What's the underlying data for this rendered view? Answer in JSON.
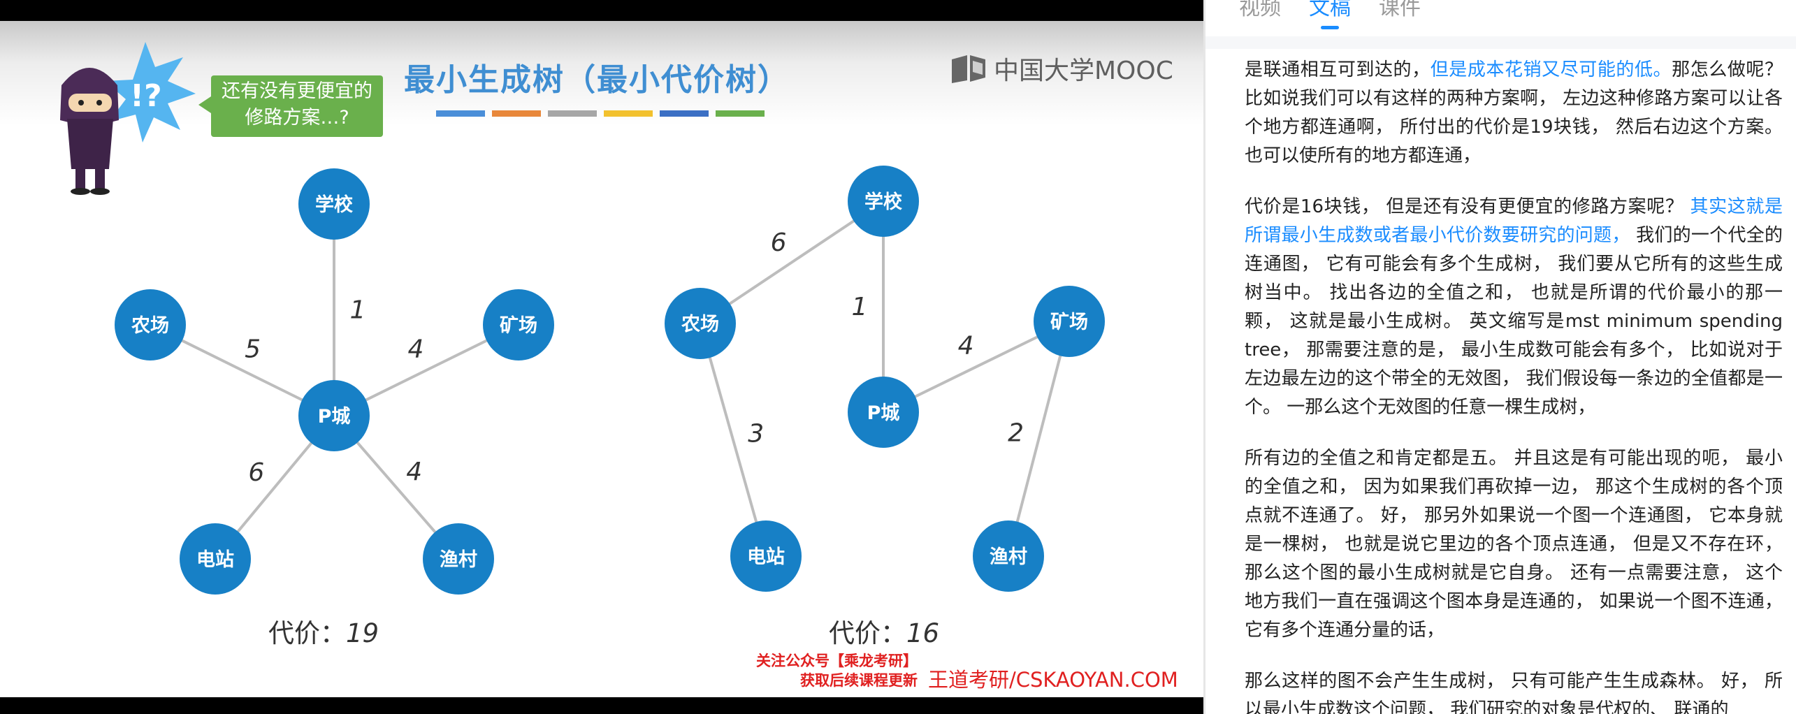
{
  "slide": {
    "title": "最小生成树（最小代价树）",
    "title_bar_colors": [
      "#4a8ed8",
      "#e8873a",
      "#a6a6a6",
      "#f2c12e",
      "#3b6fc4",
      "#6ab04c"
    ],
    "question_bubble": [
      "还有没有更便宜的",
      "修路方案…?"
    ],
    "ninja_glyph": "!?",
    "mooc_logo_icon": "mooc-book-icon",
    "mooc_logo_text": "中国大学MOOC",
    "left_cost_label": "代价：",
    "left_cost_value": "19",
    "right_cost_label": "代价：",
    "right_cost_value": "16",
    "promo_line1": "关注公众号【乘龙考研】",
    "promo_line2": "获取后续课程更新",
    "watermark": "王道考研/CSKAOYAN.COM",
    "node_color": "#1780c6",
    "edge_color": "#bdbdbd"
  },
  "left_graph": {
    "nodes": [
      "学校",
      "农场",
      "矿场",
      "P城",
      "电站",
      "渔村"
    ],
    "edges": [
      {
        "from": "P城",
        "to": "学校",
        "weight": "1"
      },
      {
        "from": "P城",
        "to": "农场",
        "weight": "5"
      },
      {
        "from": "P城",
        "to": "矿场",
        "weight": "4"
      },
      {
        "from": "P城",
        "to": "电站",
        "weight": "6"
      },
      {
        "from": "P城",
        "to": "渔村",
        "weight": "4"
      }
    ]
  },
  "right_graph": {
    "nodes": [
      "学校",
      "农场",
      "矿场",
      "P城",
      "电站",
      "渔村"
    ],
    "edges": [
      {
        "from": "学校",
        "to": "农场",
        "weight": "6"
      },
      {
        "from": "学校",
        "to": "P城",
        "weight": "1"
      },
      {
        "from": "P城",
        "to": "矿场",
        "weight": "4"
      },
      {
        "from": "农场",
        "to": "电站",
        "weight": "3"
      },
      {
        "from": "矿场",
        "to": "渔村",
        "weight": "2"
      }
    ]
  },
  "panel": {
    "tabs": [
      {
        "label": "视频",
        "active": false
      },
      {
        "label": "文稿",
        "active": true
      },
      {
        "label": "课件",
        "active": false
      }
    ],
    "paragraphs": [
      [
        {
          "t": "是联通相互可到达的，",
          "hl": false
        },
        {
          "t": "但是成本花销又尽可能的低。",
          "hl": true
        },
        {
          "t": "那怎么做呢？ 比如说我们可以有这样的两种方案啊， 左边这种修路方案可以让各个地方都连通啊， 所付出的代价是19块钱， 然后右边这个方案。 也可以使所有的地方都连通，",
          "hl": false
        }
      ],
      [
        {
          "t": "代价是16块钱， 但是还有没有更便宜的修路方案呢？ ",
          "hl": false
        },
        {
          "t": "其实这就是所谓最小生成数或者最小代价数要研究的问题，",
          "hl": true
        },
        {
          "t": " 我们的一个代全的连通图， 它有可能会有多个生成树， 我们要从它所有的这些生成树当中。 找出各边的全值之和， 也就是所谓的代价最小的那一颗， 这就是最小生成树。 英文缩写是mst minimum spending tree， 那需要注意的是， 最小生成数可能会有多个， 比如说对于左边最左边的这个带全的无效图， 我们假设每一条边的全值都是一个。 一那么这个无效图的任意一棵生成树，",
          "hl": false
        }
      ],
      [
        {
          "t": "所有边的全值之和肯定都是五。 并且这是有可能出现的呃， 最小的全值之和， 因为如果我们再砍掉一边， 那这个生成树的各个顶点就不连通了。 好， 那另外如果说一个图一个连通图， 它本身就是一棵树， 也就是说它里边的各个顶点连通， 但是又不存在环， 那么这个图的最小生成树就是它自身。 还有一点需要注意， 这个地方我们一直在强调这个图本身是连通的， 如果说一个图不连通， 它有多个连通分量的话，",
          "hl": false
        }
      ],
      [
        {
          "t": "那么这样的图不会产生生成树， 只有可能产生生成森林。 好， 所以最小生成数这个问题， 我们研究的对象是代权的、 联通的",
          "hl": false
        }
      ]
    ]
  }
}
